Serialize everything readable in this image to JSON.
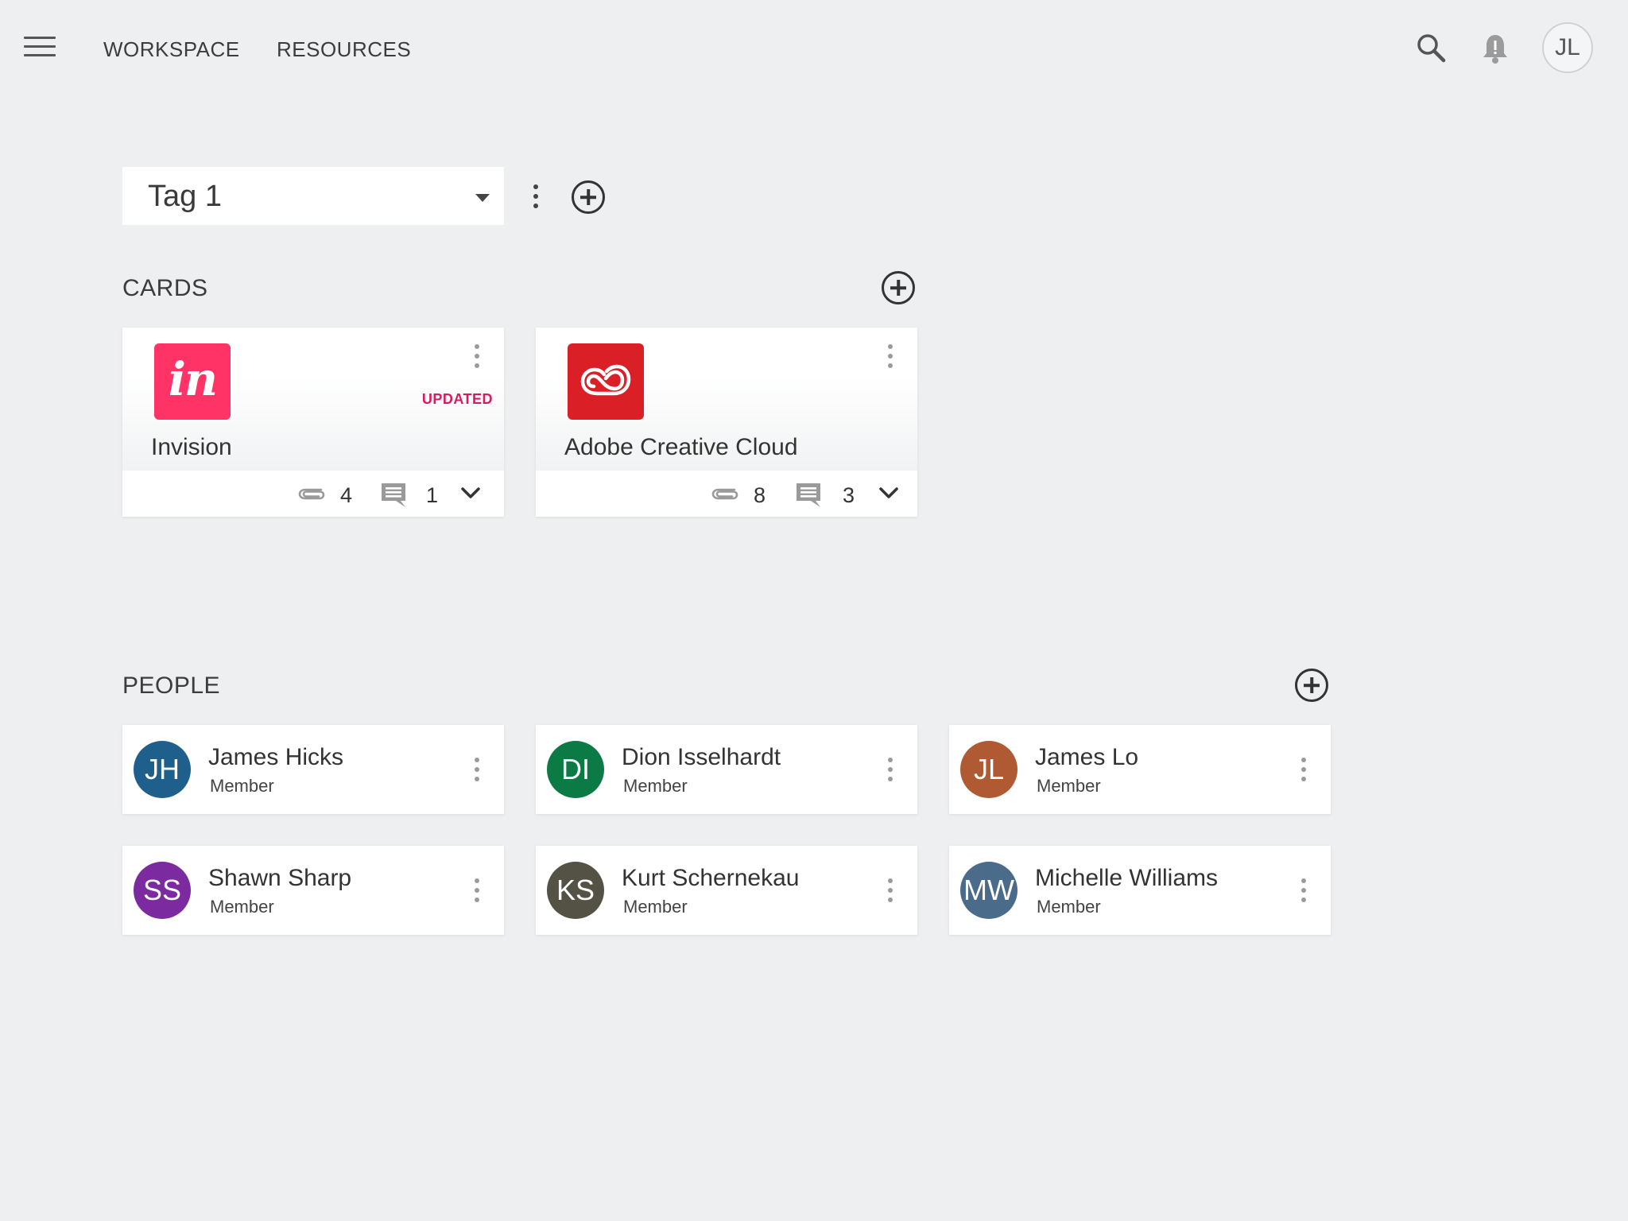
{
  "nav": {
    "workspace": "WORKSPACE",
    "resources": "RESOURCES"
  },
  "user": {
    "initials": "JL"
  },
  "tag_selector": {
    "value": "Tag 1"
  },
  "sections": {
    "cards": "CARDS",
    "people": "PEOPLE"
  },
  "cards": [
    {
      "name": "Invision",
      "logo_text": "in",
      "logo_color": "#ff3366",
      "badge": "UPDATED",
      "attachments": "4",
      "comments": "1"
    },
    {
      "name": "Adobe Creative Cloud",
      "logo_color": "#da1f26",
      "attachments": "8",
      "comments": "3"
    }
  ],
  "people": [
    {
      "initials": "JH",
      "name": "James Hicks",
      "role": "Member",
      "color": "#1f5f8b"
    },
    {
      "initials": "DI",
      "name": "Dion Isselhardt",
      "role": "Member",
      "color": "#0b7a45"
    },
    {
      "initials": "JL",
      "name": "James Lo",
      "role": "Member",
      "color": "#b05a34"
    },
    {
      "initials": "SS",
      "name": "Shawn Sharp",
      "role": "Member",
      "color": "#7b2aa0"
    },
    {
      "initials": "KS",
      "name": "Kurt Schernekau",
      "role": "Member",
      "color": "#545145"
    },
    {
      "initials": "MW",
      "name": "Michelle Williams",
      "role": "Member",
      "color": "#4a6b8a"
    }
  ],
  "colors": {
    "background": "#eeeff1",
    "badge": "#d81b60"
  },
  "icons": [
    "menu-icon",
    "search-icon",
    "bell-icon",
    "more-vert-icon",
    "add-circle-icon",
    "attachment-icon",
    "comment-icon",
    "chevron-down-icon"
  ]
}
